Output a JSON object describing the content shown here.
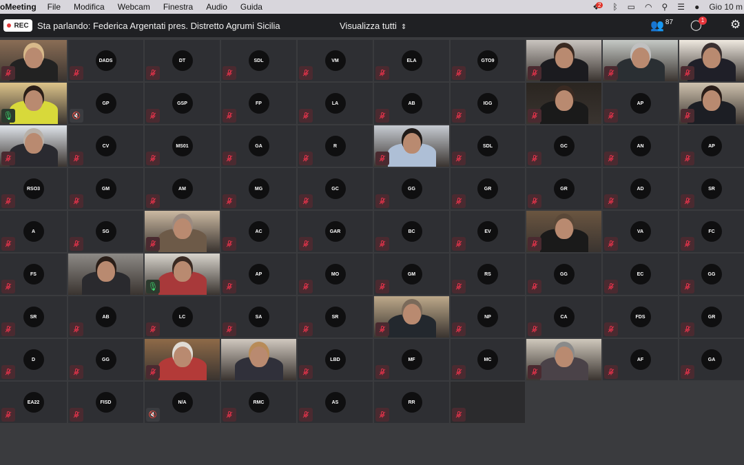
{
  "menubar": {
    "app_name": "oMeeting",
    "items": [
      "File",
      "Modifica",
      "Webcam",
      "Finestra",
      "Audio",
      "Guida"
    ],
    "clock": "Gio 10 m",
    "dropbox_badge": "2"
  },
  "toolbar": {
    "rec_label": "REC",
    "speaking_text": "Sta parlando: Federica Argentati pres. Distretto Agrumi Sicilia",
    "view_label": "Visualizza tutti",
    "participants_count": "87",
    "chat_badge": "1"
  },
  "grid": {
    "rows": [
      [
        {
          "t": "video",
          "hair": "#d8b98a",
          "bg": "#8a6d55",
          "torso": "#222"
        },
        {
          "t": "initials",
          "label": "DADS"
        },
        {
          "t": "initials",
          "label": "DT"
        },
        {
          "t": "initials",
          "label": "SDL"
        },
        {
          "t": "initials",
          "label": "VM"
        },
        {
          "t": "initials",
          "label": "ELA"
        },
        {
          "t": "initials",
          "label": "GTO9"
        },
        {
          "t": "video",
          "hair": "#3a2a22",
          "bg": "#c9c4bf",
          "torso": "#1b1b1f"
        },
        {
          "t": "video",
          "hair": "#c0c0c0",
          "bg": "#c5c9c5",
          "torso": "#2a2f33"
        },
        {
          "t": "video",
          "hair": "#3a3030",
          "bg": "#efe9e0",
          "torso": "#1f1f28"
        }
      ],
      [
        {
          "t": "video",
          "hair": "#2a1e18",
          "bg": "#ddc48a",
          "torso": "#d8d93a",
          "audio": "mic"
        },
        {
          "t": "initials",
          "label": "GP",
          "audio": "off"
        },
        {
          "t": "initials",
          "label": "GSP"
        },
        {
          "t": "initials",
          "label": "FP"
        },
        {
          "t": "initials",
          "label": "LA"
        },
        {
          "t": "initials",
          "label": "AB"
        },
        {
          "t": "initials",
          "label": "IGG"
        },
        {
          "t": "video",
          "hair": "#3a2a22",
          "bg": "#2a2520",
          "torso": "#1a1a1a"
        },
        {
          "t": "initials",
          "label": "AP"
        },
        {
          "t": "video",
          "hair": "#2a1d18",
          "bg": "#cfc2ae",
          "torso": "#1c1e24"
        }
      ],
      [
        {
          "t": "video",
          "hair": "#b8b0a8",
          "bg": "#dfe4ea",
          "torso": "#2a2a30"
        },
        {
          "t": "initials",
          "label": "CV"
        },
        {
          "t": "initials",
          "label": "MS01"
        },
        {
          "t": "initials",
          "label": "GA"
        },
        {
          "t": "initials",
          "label": "R"
        },
        {
          "t": "video",
          "hair": "#1f1a18",
          "bg": "#c7ccd3",
          "torso": "#aebfd6"
        },
        {
          "t": "initials",
          "label": "SDL"
        },
        {
          "t": "initials",
          "label": "GC"
        },
        {
          "t": "initials",
          "label": "AN"
        },
        {
          "t": "initials",
          "label": "AP"
        }
      ],
      [
        {
          "t": "initials",
          "label": "RSO3"
        },
        {
          "t": "initials",
          "label": "GM"
        },
        {
          "t": "initials",
          "label": "AM"
        },
        {
          "t": "initials",
          "label": "MG"
        },
        {
          "t": "initials",
          "label": "GC"
        },
        {
          "t": "initials",
          "label": "GG"
        },
        {
          "t": "initials",
          "label": "GR"
        },
        {
          "t": "initials",
          "label": "GR"
        },
        {
          "t": "initials",
          "label": "AD"
        },
        {
          "t": "initials",
          "label": "SR"
        }
      ],
      [
        {
          "t": "initials",
          "label": "A"
        },
        {
          "t": "initials",
          "label": "SG"
        },
        {
          "t": "video",
          "hair": "#9a8a80",
          "bg": "#cbb9a2",
          "torso": "#6d5a48"
        },
        {
          "t": "initials",
          "label": "AC"
        },
        {
          "t": "initials",
          "label": "GAR"
        },
        {
          "t": "initials",
          "label": "BC"
        },
        {
          "t": "initials",
          "label": "EV"
        },
        {
          "t": "video",
          "hair": "#5a4838",
          "bg": "#6a5540",
          "torso": "#1a1a1a"
        },
        {
          "t": "initials",
          "label": "VA"
        },
        {
          "t": "initials",
          "label": "FC"
        }
      ],
      [
        {
          "t": "initials",
          "label": "FS"
        },
        {
          "t": "video",
          "hair": "#2a1e18",
          "bg": "#8d8a86",
          "torso": "#2a2a2e",
          "audio": "none"
        },
        {
          "t": "video",
          "hair": "#3a2a22",
          "bg": "#d8d4cc",
          "torso": "#a8393a",
          "audio": "mic"
        },
        {
          "t": "initials",
          "label": "AP"
        },
        {
          "t": "initials",
          "label": "MO"
        },
        {
          "t": "initials",
          "label": "GM"
        },
        {
          "t": "initials",
          "label": "RS"
        },
        {
          "t": "initials",
          "label": "GG"
        },
        {
          "t": "initials",
          "label": "EC"
        },
        {
          "t": "initials",
          "label": "GG"
        }
      ],
      [
        {
          "t": "initials",
          "label": "SR"
        },
        {
          "t": "initials",
          "label": "AB"
        },
        {
          "t": "initials",
          "label": "LC"
        },
        {
          "t": "initials",
          "label": "SA"
        },
        {
          "t": "initials",
          "label": "SR"
        },
        {
          "t": "video",
          "hair": "#7a6a5a",
          "bg": "#bda98a",
          "torso": "#23282e"
        },
        {
          "t": "initials",
          "label": "NP"
        },
        {
          "t": "initials",
          "label": "CA"
        },
        {
          "t": "initials",
          "label": "FDS"
        },
        {
          "t": "initials",
          "label": "GR"
        }
      ],
      [
        {
          "t": "initials",
          "label": "D"
        },
        {
          "t": "initials",
          "label": "GG"
        },
        {
          "t": "video",
          "hair": "#e0dcd6",
          "bg": "#8e6a48",
          "torso": "#b33a38"
        },
        {
          "t": "video",
          "hair": "#b88b58",
          "bg": "#d0c8bf",
          "torso": "#30303a",
          "audio": "none"
        },
        {
          "t": "initials",
          "label": "LBD"
        },
        {
          "t": "initials",
          "label": "MF"
        },
        {
          "t": "initials",
          "label": "MC"
        },
        {
          "t": "video",
          "hair": "#8a8a8a",
          "bg": "#cfc8bc",
          "torso": "#4a4248"
        },
        {
          "t": "initials",
          "label": "AF"
        },
        {
          "t": "initials",
          "label": "GA"
        }
      ],
      [
        {
          "t": "initials",
          "label": "EA22"
        },
        {
          "t": "initials",
          "label": "FISD"
        },
        {
          "t": "initials",
          "label": "N/A",
          "audio": "off"
        },
        {
          "t": "initials",
          "label": "RMC"
        },
        {
          "t": "initials",
          "label": "AS"
        },
        {
          "t": "initials",
          "label": "RR"
        },
        {
          "t": "blank"
        }
      ]
    ]
  },
  "colors": {
    "mute_icon": "#e2334a",
    "tile_bg": "#2e2f33",
    "page_bg": "#3a3b3e"
  }
}
